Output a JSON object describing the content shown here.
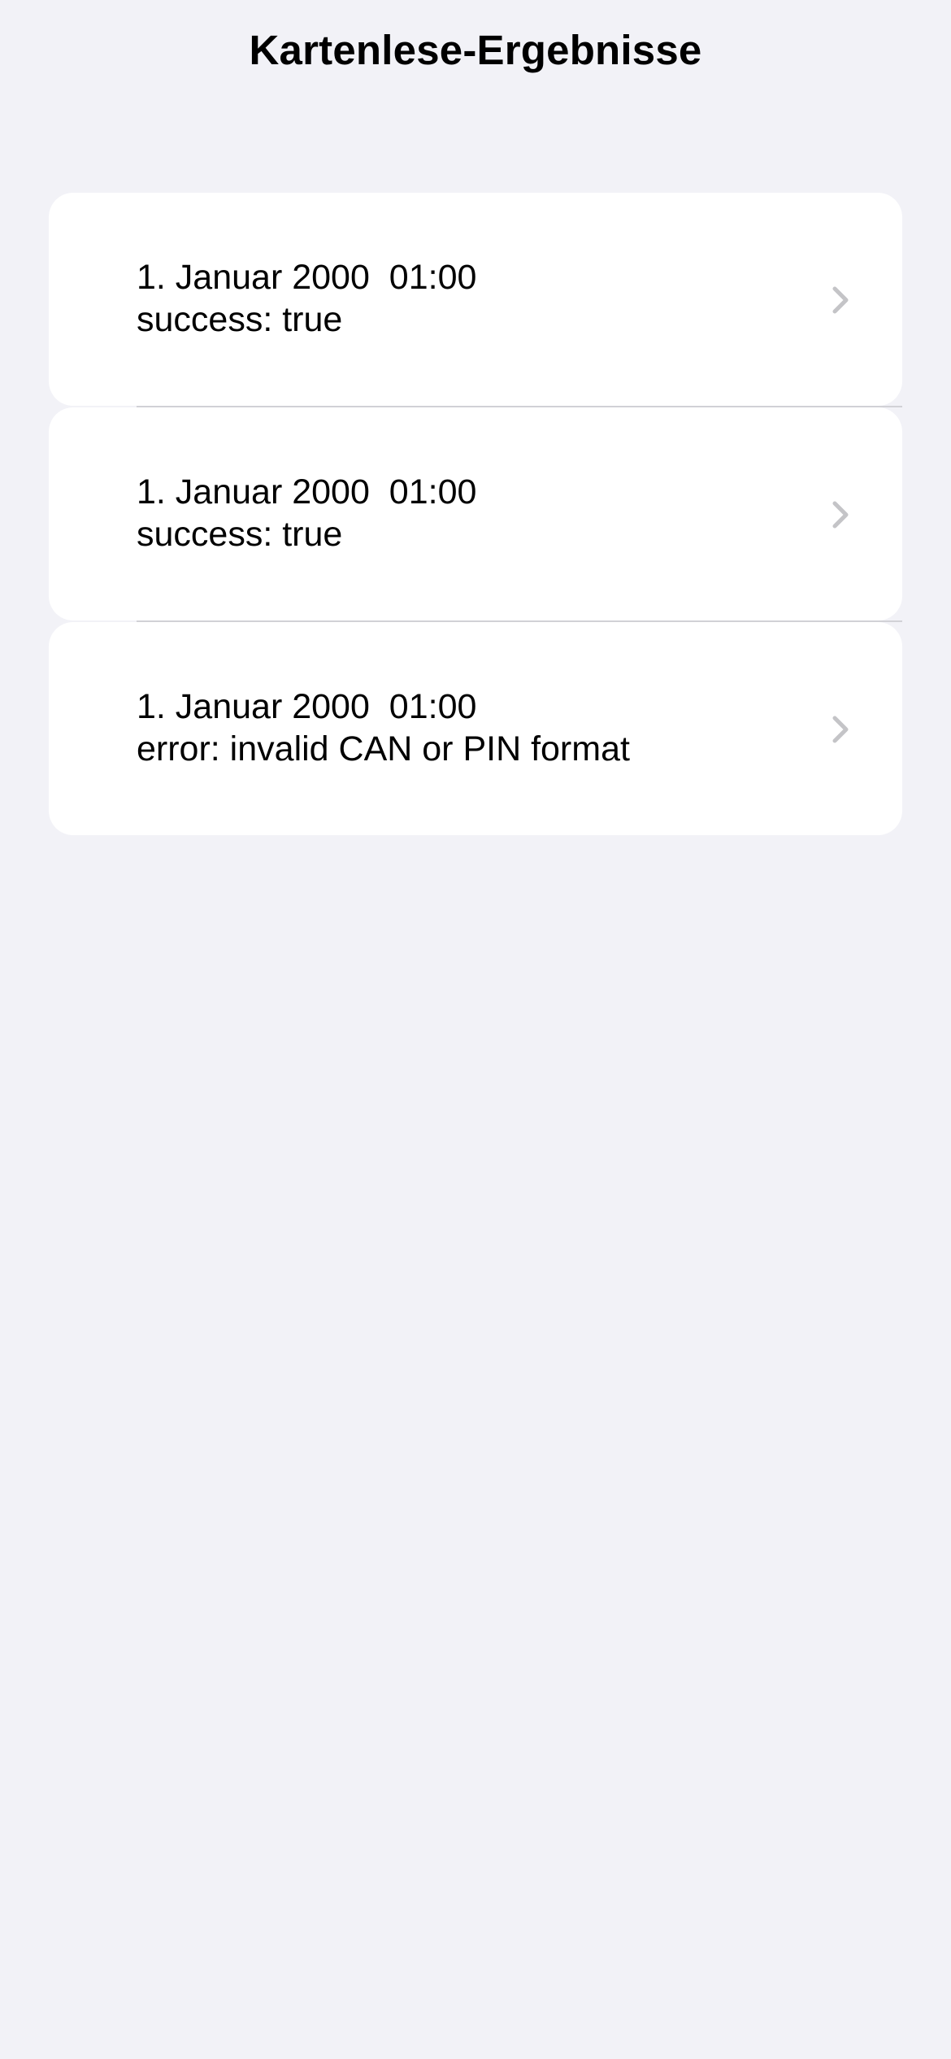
{
  "colors": {
    "background": "#f2f2f7",
    "card": "#ffffff",
    "separator": "#d1d1d6",
    "chevron": "#c4c4c7",
    "text": "#000000"
  },
  "nav": {
    "title": "Kartenlese-Ergebnisse"
  },
  "results": [
    {
      "date": "1. Januar 2000",
      "time": "01:00",
      "status": "success: true",
      "icon": "chevron-right-icon"
    },
    {
      "date": "1. Januar 2000",
      "time": "01:00",
      "status": "success: true",
      "icon": "chevron-right-icon"
    },
    {
      "date": "1. Januar 2000",
      "time": "01:00",
      "status": "error: invalid CAN or PIN format",
      "icon": "chevron-right-icon"
    }
  ]
}
